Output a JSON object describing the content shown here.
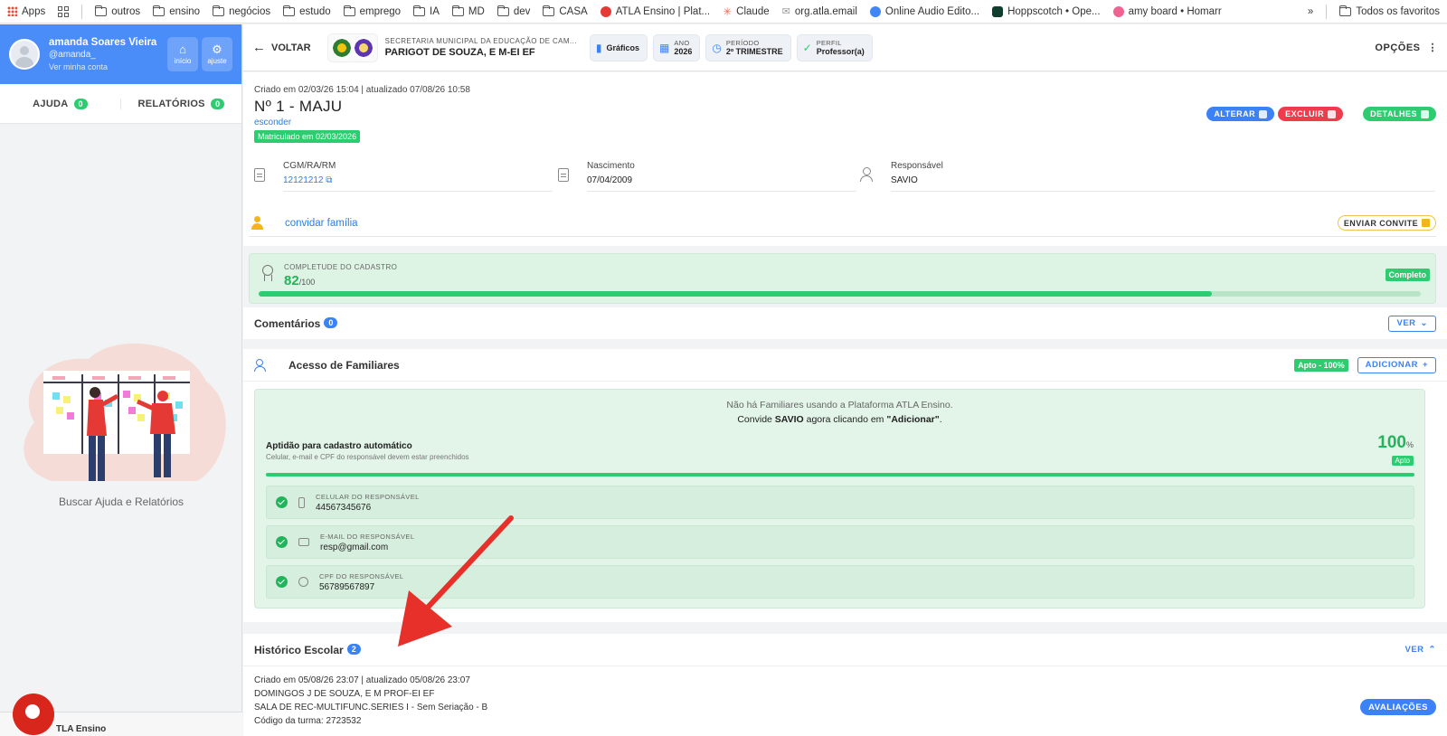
{
  "bookmarks": {
    "apps": "Apps",
    "items": [
      "outros",
      "ensino",
      "negócios",
      "estudo",
      "emprego",
      "IA",
      "MD",
      "dev",
      "CASA",
      "ATLA Ensino | Plat...",
      "Claude",
      "org.atla.email",
      "Online Audio Edito...",
      "Hoppscotch • Ope...",
      "amy board • Homarr"
    ],
    "more": "»",
    "all_favorites": "Todos os favoritos"
  },
  "sidebar": {
    "name": "amanda Soares Vieira",
    "username": "@amanda_",
    "account_link": "Ver minha conta",
    "home_label": "início",
    "settings_label": "ajuste",
    "tabs": [
      {
        "label": "AJUDA",
        "count": "0"
      },
      {
        "label": "RELATÓRIOS",
        "count": "0"
      }
    ],
    "help_text": "Buscar Ajuda e Relatórios",
    "bottom_label": "TLA Ensino"
  },
  "header": {
    "back_label": "VOLTAR",
    "school_top": "SECRETARIA MUNICIPAL DA EDUCAÇÃO DE CAM...",
    "school_name": "PARIGOT DE SOUZA, E M-EI EF",
    "chips": [
      {
        "key": "",
        "value": "Gráficos"
      },
      {
        "key": "ANO",
        "value": "2026"
      },
      {
        "key": "PERÍODO",
        "value": "2º TRIMESTRE"
      },
      {
        "key": "PERFIL",
        "value": "Professor(a)"
      }
    ],
    "options_label": "OPÇÕES"
  },
  "student": {
    "created": "Criado em 02/03/26 15:04 | atualizado 07/08/26 10:58",
    "name": "Nº 1 - MAJU",
    "hide_link": "esconder",
    "enrolled": "Matriculado em 02/03/2026",
    "actions": {
      "edit": "ALTERAR",
      "delete": "EXCLUIR",
      "details": "DETALHES"
    },
    "fields": [
      {
        "key": "CGM/RA/RM",
        "value": "12121212"
      },
      {
        "key": "Nascimento",
        "value": "07/04/2009"
      },
      {
        "key": "Responsável",
        "value": "SAVIO"
      }
    ],
    "invite_link": "convidar família",
    "invite_button": "ENVIAR CONVITE"
  },
  "completeness": {
    "label": "COMPLETUDE DO CADASTRO",
    "value": "82",
    "max": "/100",
    "status": "Completo",
    "fraction": 0.82
  },
  "comments": {
    "title": "Comentários",
    "count": "0",
    "button": "VER"
  },
  "family_access": {
    "title": "Acesso de Familiares",
    "status_badge": "Apto - 100%",
    "add_button": "ADICIONAR",
    "message1": "Não há Familiares usando a Plataforma ATLA Ensino.",
    "message2": "Convide SAVIO agora clicando em \"Adicionar\".",
    "aptitude_title": "Aptidão para cadastro automático",
    "aptitude_sub": "Celular, e-mail e CPF do responsável devem estar preenchidos",
    "aptitude_value": "100",
    "aptitude_unit": "%",
    "aptitude_badge": "Apto",
    "aptitude_fraction": 1.0,
    "requirements": [
      {
        "key": "CELULAR DO RESPONSÁVEL",
        "value": "44567345676",
        "icon": "phone-icon"
      },
      {
        "key": "E-MAIL DO RESPONSÁVEL",
        "value": "resp@gmail.com",
        "icon": "mail-icon"
      },
      {
        "key": "CPF DO RESPONSÁVEL",
        "value": "56789567897",
        "icon": "fingerprint-icon"
      }
    ]
  },
  "history": {
    "title": "Histórico Escolar",
    "count": "2",
    "button": "VER",
    "lines": [
      "Criado em 05/08/26 23:07 | atualizado 05/08/26 23:07",
      "DOMINGOS J DE SOUZA, E M PROF-EI EF",
      "SALA DE REC-MULTIFUNC.SERIES I - Sem Seriação - B",
      "Código da turma: 2723532"
    ],
    "evaluations_button": "AVALIAÇÕES"
  },
  "colors": {
    "accent_blue": "#3b82f6",
    "profile_blue": "#4a8df8",
    "success_green": "#2ecc71",
    "danger_red": "#ef3b4b",
    "arrow_red": "#e8302a"
  }
}
